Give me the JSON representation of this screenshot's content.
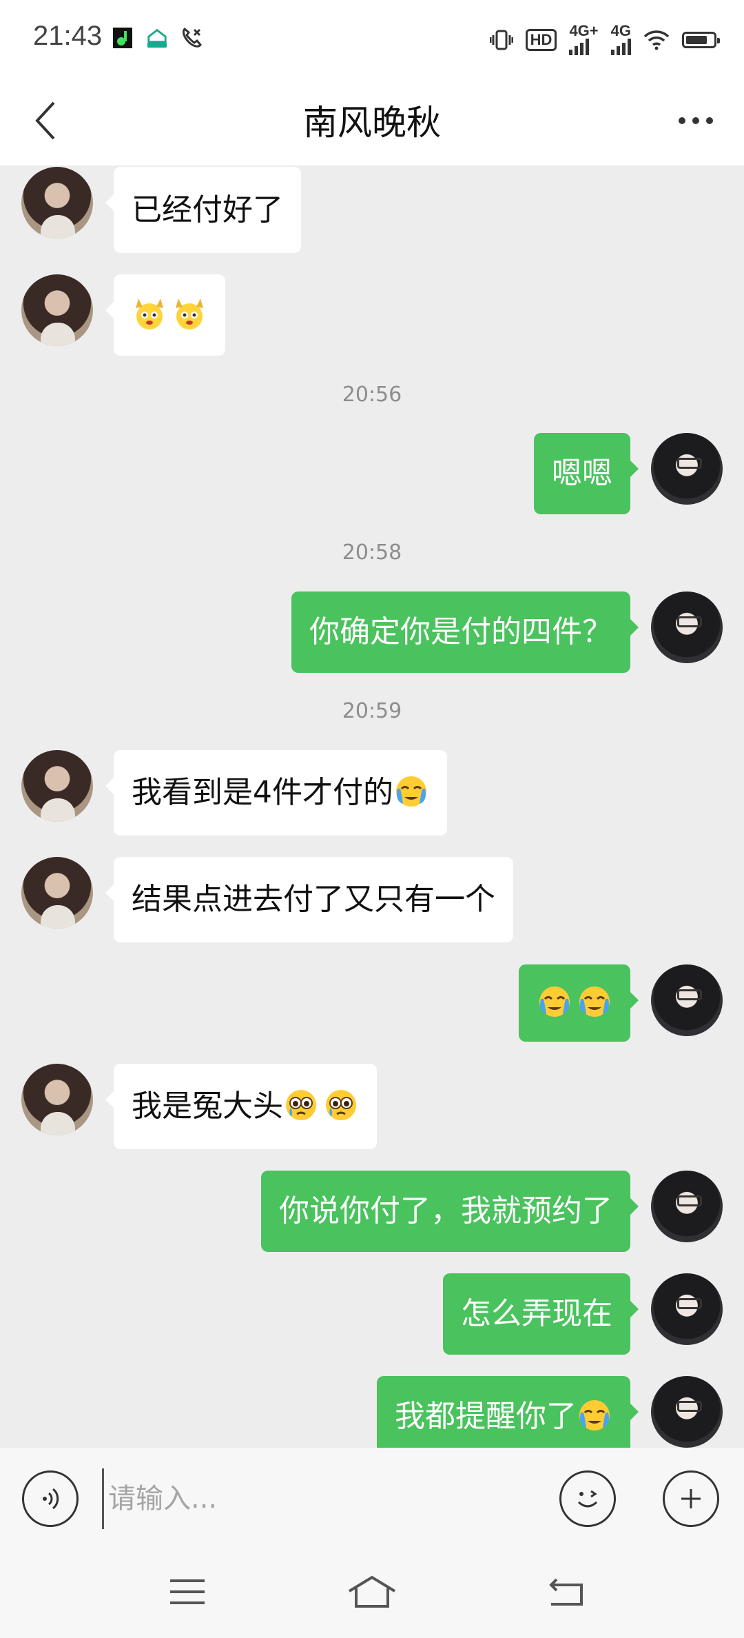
{
  "status_bar": {
    "time": "21:43",
    "left_icons": [
      "music-app-icon",
      "vpn-home-icon",
      "call-icon"
    ],
    "hd_label": "HD",
    "signal_1_label": "4G+",
    "signal_2_label": "4G",
    "battery_level": 0.8
  },
  "header": {
    "title": "南风晚秋",
    "back_icon": "chevron-left-icon",
    "more_icon": "more-dots-icon"
  },
  "messages": [
    {
      "side": "them",
      "text": "已经付好了"
    },
    {
      "side": "them",
      "text": "",
      "emojis": [
        "hands-up-emoji",
        "hands-up-emoji"
      ]
    },
    {
      "type": "timestamp",
      "text": "20:56"
    },
    {
      "side": "me",
      "text": "嗯嗯"
    },
    {
      "type": "timestamp",
      "text": "20:58"
    },
    {
      "side": "me",
      "text": "你确定你是付的四件？"
    },
    {
      "type": "timestamp",
      "text": "20:59"
    },
    {
      "side": "them",
      "text": "我看到是4件才付的",
      "emojis": [
        "crying-emoji"
      ]
    },
    {
      "side": "them",
      "text": "结果点进去付了又只有一个"
    },
    {
      "side": "me",
      "text": "",
      "emojis": [
        "crying-emoji",
        "crying-emoji"
      ]
    },
    {
      "side": "them",
      "text": "我是冤大头",
      "emojis": [
        "teary-emoji",
        "teary-emoji"
      ]
    },
    {
      "side": "me",
      "text": "你说你付了，我就预约了"
    },
    {
      "side": "me",
      "text": "怎么弄现在"
    },
    {
      "side": "me",
      "text": "我都提醒你了",
      "emojis": [
        "crying-emoji"
      ]
    }
  ],
  "input_bar": {
    "placeholder": "请输入...",
    "value": "",
    "voice_icon": "voice-icon",
    "emoji_icon": "smiley-icon",
    "plus_icon": "plus-icon"
  },
  "nav_bar": {
    "menu_icon": "menu-icon",
    "home_icon": "home-icon",
    "back_icon": "back-arrow-icon"
  },
  "colors": {
    "background": "#ededed",
    "my_bubble": "#4ac25d",
    "their_bubble": "#ffffff",
    "timestamp": "#8d8d8d"
  }
}
